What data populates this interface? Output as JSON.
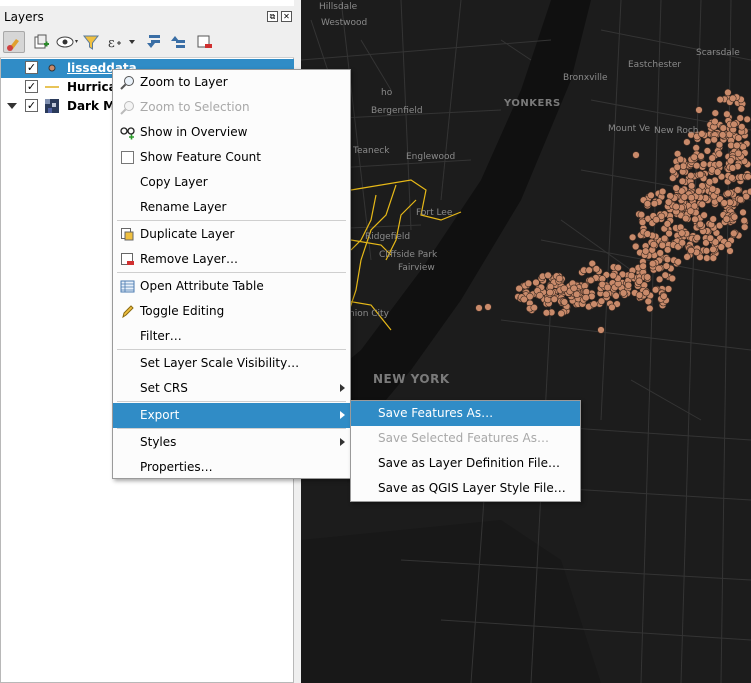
{
  "panel": {
    "title": "Layers",
    "float_glyph": "⧉",
    "close_glyph": "✕"
  },
  "toolbar": {
    "icons": [
      "style-manager-icon",
      "add-group-icon",
      "visibility-eye-icon",
      "filter-legend-icon",
      "filter-expression-icon",
      "expand-all-icon",
      "collapse-all-icon",
      "remove-layer-icon"
    ]
  },
  "layers": [
    {
      "name": "lisseddata",
      "checked": "✓",
      "selected": true
    },
    {
      "name": "Hurricai",
      "checked": "✓",
      "selected": false
    },
    {
      "name": "Dark Ma",
      "checked": "✓",
      "selected": false
    }
  ],
  "map": {
    "labels": [
      "Hillsdale",
      "Westwood",
      "Bergenfield",
      "YONKERS",
      "Teaneck",
      "Englewood",
      "Mount Ve",
      "New Roch",
      "Bronxville",
      "Eastchester",
      "Scarsdale",
      "ho",
      "Fort Lee",
      "Ridgefield",
      "Cliffside Park",
      "Fairview",
      "nion City",
      "NEW YORK"
    ],
    "colors": {
      "background": "#1c1c1c",
      "roads": "#3a3a3a",
      "highways": "#f0c419",
      "points": "#c98a6a",
      "water": "#101010"
    }
  },
  "menu": {
    "items": [
      {
        "label": "Zoom to Layer",
        "icon": "zoom-layer-icon",
        "disabled": false
      },
      {
        "label": "Zoom to Selection",
        "icon": "zoom-selection-icon",
        "disabled": true
      },
      {
        "label": "Show in Overview",
        "icon": "overview-glasses-icon",
        "disabled": false
      },
      {
        "label": "Show Feature Count",
        "icon": "checkbox-icon",
        "disabled": false
      },
      {
        "label": "Copy Layer",
        "icon": "",
        "disabled": false
      },
      {
        "label": "Rename Layer",
        "icon": "",
        "disabled": false
      },
      {
        "label": "Duplicate Layer",
        "icon": "duplicate-layer-icon",
        "disabled": false
      },
      {
        "label": "Remove Layer…",
        "icon": "remove-layer-icon",
        "disabled": false
      },
      {
        "label": "Open Attribute Table",
        "icon": "attribute-table-icon",
        "disabled": false
      },
      {
        "label": "Toggle Editing",
        "icon": "pencil-icon",
        "disabled": false
      },
      {
        "label": "Filter…",
        "icon": "",
        "disabled": false
      },
      {
        "label": "Set Layer Scale Visibility…",
        "icon": "",
        "disabled": false
      },
      {
        "label": "Set CRS",
        "icon": "",
        "disabled": false,
        "submenu": true
      },
      {
        "label": "Export",
        "icon": "",
        "disabled": false,
        "submenu": true,
        "highlighted": true
      },
      {
        "label": "Styles",
        "icon": "",
        "disabled": false,
        "submenu": true
      },
      {
        "label": "Properties…",
        "icon": "",
        "disabled": false
      }
    ]
  },
  "submenu": {
    "items": [
      {
        "label": "Save Features As…",
        "disabled": false,
        "highlighted": true
      },
      {
        "label": "Save Selected Features As…",
        "disabled": true
      },
      {
        "label": "Save as Layer Definition File…",
        "disabled": false
      },
      {
        "label": "Save as QGIS Layer Style File…",
        "disabled": false
      }
    ]
  }
}
